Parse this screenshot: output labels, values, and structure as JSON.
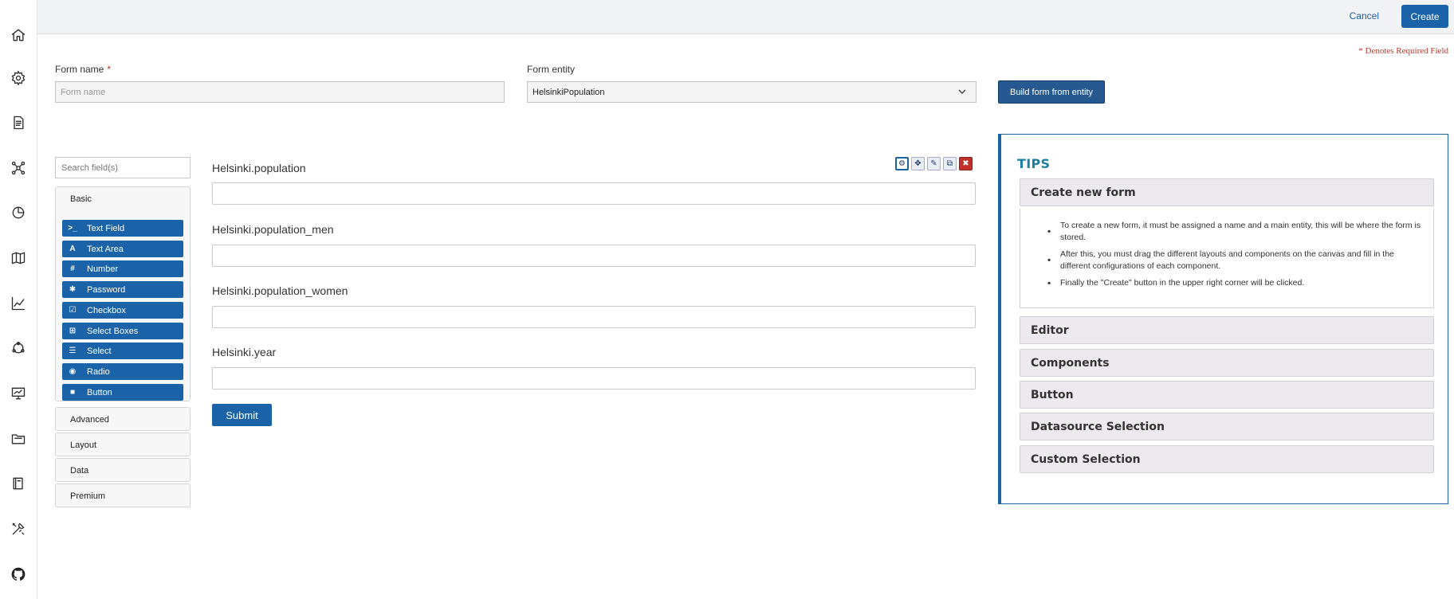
{
  "sidebar": {
    "icons": [
      "home-icon",
      "gear-icon",
      "document-icon",
      "network-icon",
      "pie-chart-icon",
      "map-icon",
      "line-chart-icon",
      "cycle-icon",
      "presentation-icon",
      "folder-icon",
      "book-icon",
      "tools-icon",
      "github-icon"
    ]
  },
  "topbar": {
    "cancel_label": "Cancel",
    "create_label": "Create"
  },
  "required_note": "* Denotes Required Field",
  "form": {
    "name_label": "Form name",
    "required_star": "*",
    "name_placeholder": "Form name",
    "name_value": "",
    "entity_label": "Form entity",
    "entity_value": "HelsinkiPopulation",
    "build_label": "Build form from entity"
  },
  "palette": {
    "search_placeholder": "Search field(s)",
    "basic_label": "Basic",
    "components": [
      {
        "icon": ">_",
        "label": "Text Field"
      },
      {
        "icon": "A",
        "label": "Text Area"
      },
      {
        "icon": "#",
        "label": "Number"
      },
      {
        "icon": "✱",
        "label": "Password"
      },
      {
        "icon": "☑",
        "label": "Checkbox"
      },
      {
        "icon": "⊞",
        "label": "Select Boxes"
      },
      {
        "icon": "☰",
        "label": "Select"
      },
      {
        "icon": "◉",
        "label": "Radio"
      },
      {
        "icon": "■",
        "label": "Button"
      }
    ],
    "groups": [
      "Advanced",
      "Layout",
      "Data",
      "Premium"
    ]
  },
  "canvas": {
    "fields": [
      {
        "label": "Helsinki.population"
      },
      {
        "label": "Helsinki.population_men"
      },
      {
        "label": "Helsinki.population_women"
      },
      {
        "label": "Helsinki.year"
      }
    ],
    "submit_label": "Submit",
    "tool_icons": [
      "⚙",
      "✥",
      "✎",
      "⧉",
      "✖"
    ]
  },
  "tips": {
    "title": "TIPS",
    "sections": [
      "Create new form",
      "Editor",
      "Components",
      "Button",
      "Datasource Selection",
      "Custom Selection"
    ],
    "create_form_items": [
      "To create a new form, it must be assigned a name and a main entity, this will be where the form is stored.",
      "After this, you must drag the different layouts and components on the canvas and fill in the different configurations of each component.",
      "Finally the \"Create\" button in the upper right corner will be clicked."
    ]
  }
}
